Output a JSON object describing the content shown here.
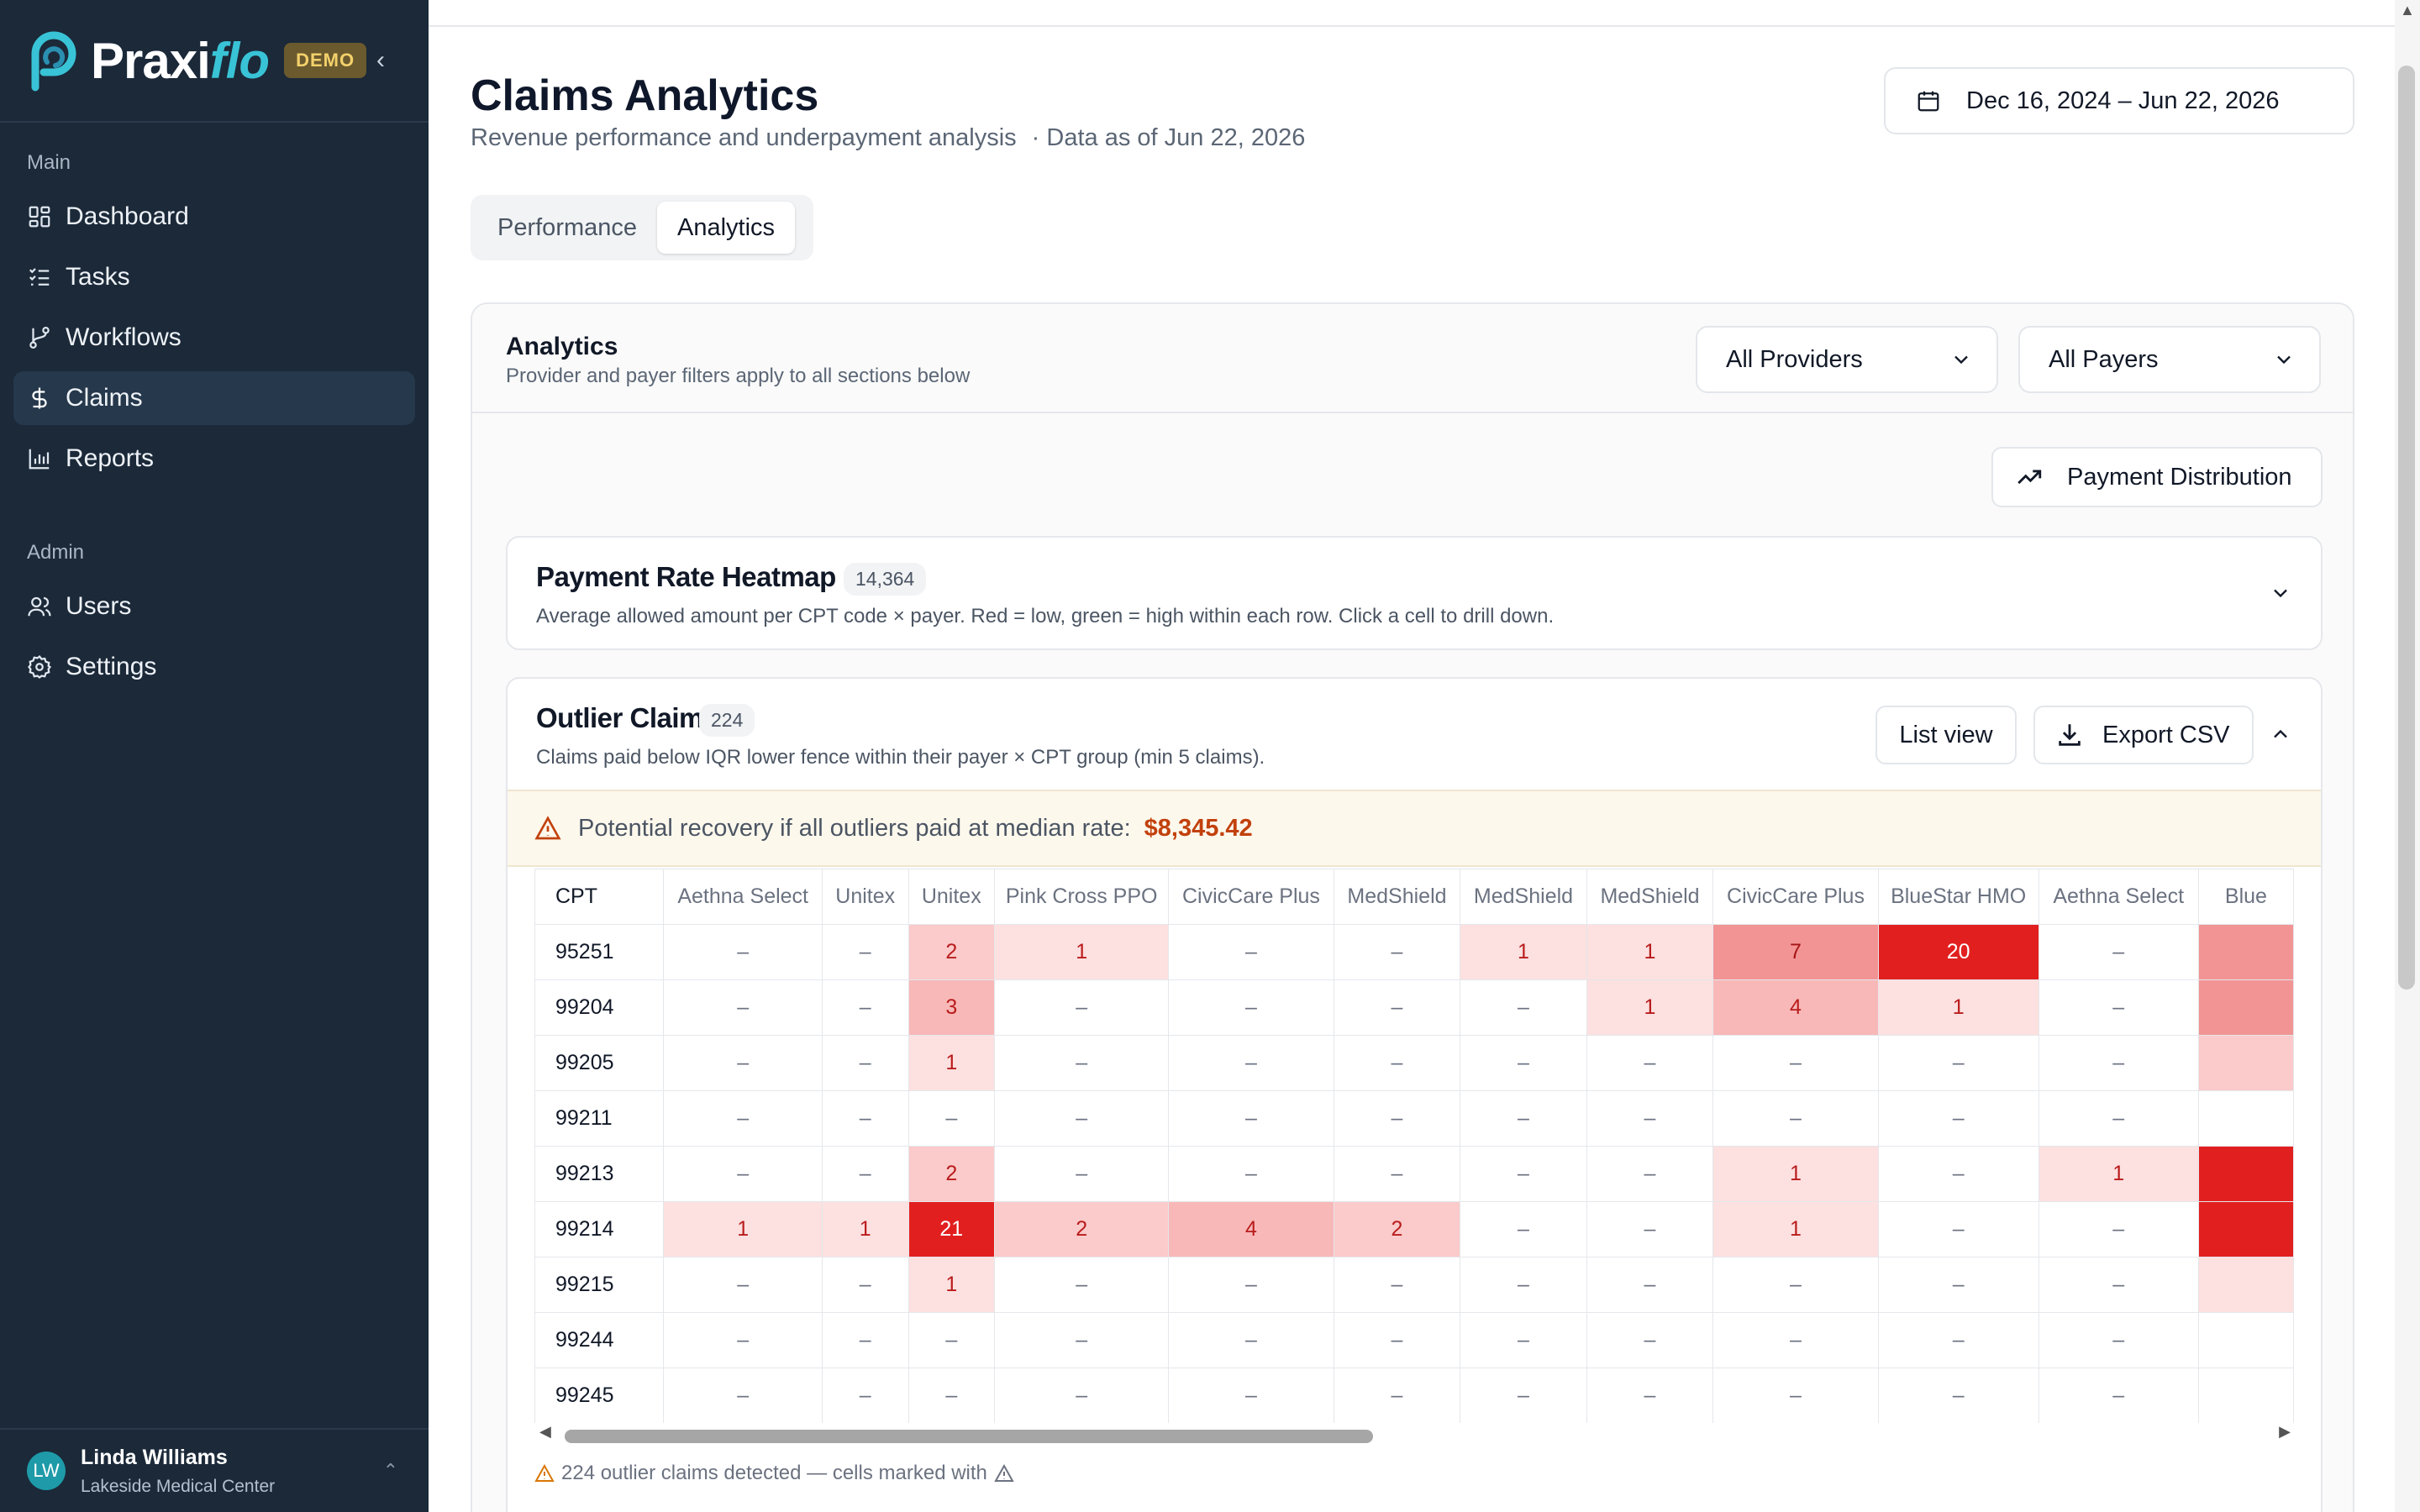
{
  "brand": {
    "name_main": "Praxi",
    "name_accent": "flo",
    "badge": "DEMO"
  },
  "nav": {
    "main_title": "Main",
    "main_items": [
      {
        "label": "Dashboard",
        "icon": "dashboard-icon"
      },
      {
        "label": "Tasks",
        "icon": "tasks-icon"
      },
      {
        "label": "Workflows",
        "icon": "workflows-icon"
      },
      {
        "label": "Claims",
        "icon": "dollar-icon",
        "active": true
      },
      {
        "label": "Reports",
        "icon": "bar-chart-icon"
      }
    ],
    "admin_title": "Admin",
    "admin_items": [
      {
        "label": "Users",
        "icon": "users-icon"
      },
      {
        "label": "Settings",
        "icon": "gear-icon"
      }
    ]
  },
  "user": {
    "initials": "LW",
    "name": "Linda Williams",
    "org": "Lakeside Medical Center"
  },
  "header": {
    "title": "Claims Analytics",
    "subtitle": "Revenue performance and underpayment analysis",
    "data_as_of": "· Data as of Jun 22, 2026",
    "date_range": "Dec 16, 2024 – Jun 22, 2026"
  },
  "tabs": [
    {
      "label": "Performance"
    },
    {
      "label": "Analytics",
      "active": true
    }
  ],
  "analytics": {
    "title": "Analytics",
    "subtitle": "Provider and payer filters apply to all sections below",
    "provider_filter": "All Providers",
    "payer_filter": "All Payers",
    "payment_distribution_label": "Payment Distribution"
  },
  "heatmap": {
    "title": "Payment Rate Heatmap",
    "count": "14,364",
    "subtitle": "Average allowed amount per CPT code × payer. Red = low, green = high within each row. Click a cell to drill down."
  },
  "outliers": {
    "title": "Outlier Claims",
    "count": "224",
    "subtitle": "Claims paid below IQR lower fence within their payer × CPT group (min 5 claims).",
    "list_view_label": "List view",
    "export_label": "Export CSV",
    "recovery_text": "Potential recovery if all outliers paid at median rate:",
    "recovery_amount": "$8,345.42",
    "footnote": "224 outlier claims detected — cells marked with",
    "columns": [
      "CPT",
      "Aethna Select",
      "Unitex",
      "Unitex",
      "Pink Cross PPO",
      "CivicCare Plus",
      "MedShield",
      "MedShield",
      "MedShield",
      "CivicCare Plus",
      "BlueStar HMO",
      "Aethna Select",
      "Blue"
    ],
    "rows": [
      {
        "cpt": "95251",
        "cells": [
          "–",
          "–",
          "2",
          "1",
          "–",
          "–",
          "1",
          "1",
          "7",
          "20",
          "–",
          ""
        ]
      },
      {
        "cpt": "99204",
        "cells": [
          "–",
          "–",
          "3",
          "–",
          "–",
          "–",
          "–",
          "1",
          "4",
          "1",
          "–",
          ""
        ]
      },
      {
        "cpt": "99205",
        "cells": [
          "–",
          "–",
          "1",
          "–",
          "–",
          "–",
          "–",
          "–",
          "–",
          "–",
          "–",
          ""
        ]
      },
      {
        "cpt": "99211",
        "cells": [
          "–",
          "–",
          "–",
          "–",
          "–",
          "–",
          "–",
          "–",
          "–",
          "–",
          "–",
          ""
        ]
      },
      {
        "cpt": "99213",
        "cells": [
          "–",
          "–",
          "2",
          "–",
          "–",
          "–",
          "–",
          "–",
          "1",
          "–",
          "1",
          ""
        ]
      },
      {
        "cpt": "99214",
        "cells": [
          "1",
          "1",
          "21",
          "2",
          "4",
          "2",
          "–",
          "–",
          "1",
          "–",
          "–",
          ""
        ]
      },
      {
        "cpt": "99215",
        "cells": [
          "–",
          "–",
          "1",
          "–",
          "–",
          "–",
          "–",
          "–",
          "–",
          "–",
          "–",
          ""
        ]
      },
      {
        "cpt": "99244",
        "cells": [
          "–",
          "–",
          "–",
          "–",
          "–",
          "–",
          "–",
          "–",
          "–",
          "–",
          "–",
          ""
        ]
      },
      {
        "cpt": "99245",
        "cells": [
          "–",
          "–",
          "–",
          "–",
          "–",
          "–",
          "–",
          "–",
          "–",
          "–",
          "–",
          ""
        ]
      }
    ],
    "partial_column_levels": [
      "v5",
      "v5",
      "v2",
      "none",
      "v6",
      "v6",
      "v1",
      "none",
      "none"
    ]
  },
  "colors": {
    "sidebar_bg": "#1b2939",
    "accent": "#39c3d6",
    "recovery": "#c2410c",
    "heat_max": "#e21f1f"
  }
}
